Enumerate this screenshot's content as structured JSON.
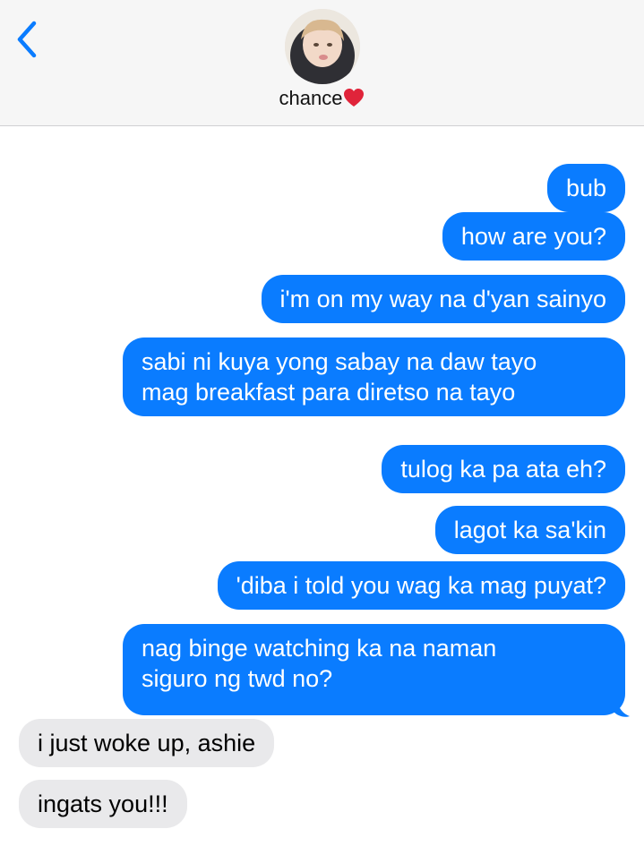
{
  "header": {
    "back_icon": "chevron-left-icon",
    "contact_name": "chance",
    "contact_emoji": "red-heart-icon"
  },
  "colors": {
    "sent_bubble": "#0a7cff",
    "received_bubble": "#e9e9eb",
    "accent": "#0a7cff",
    "heart": "#e0243a"
  },
  "messages": [
    {
      "direction": "sent",
      "text": "bub"
    },
    {
      "direction": "sent",
      "text": "how are you?"
    },
    {
      "direction": "sent",
      "text": "i'm on my way na d'yan sainyo"
    },
    {
      "direction": "sent",
      "lines": [
        "sabi ni kuya yong sabay na daw tayo",
        "mag breakfast para diretso na tayo"
      ]
    },
    {
      "direction": "sent",
      "text": "tulog ka pa ata eh?"
    },
    {
      "direction": "sent",
      "text": "lagot ka sa'kin"
    },
    {
      "direction": "sent",
      "text": "'diba i told you wag ka mag puyat?"
    },
    {
      "direction": "sent",
      "lines": [
        "nag binge watching ka na naman",
        "siguro ng twd no?"
      ]
    },
    {
      "direction": "received",
      "text": "i just woke up, ashie"
    },
    {
      "direction": "received",
      "text": "ingats you!!!"
    }
  ]
}
